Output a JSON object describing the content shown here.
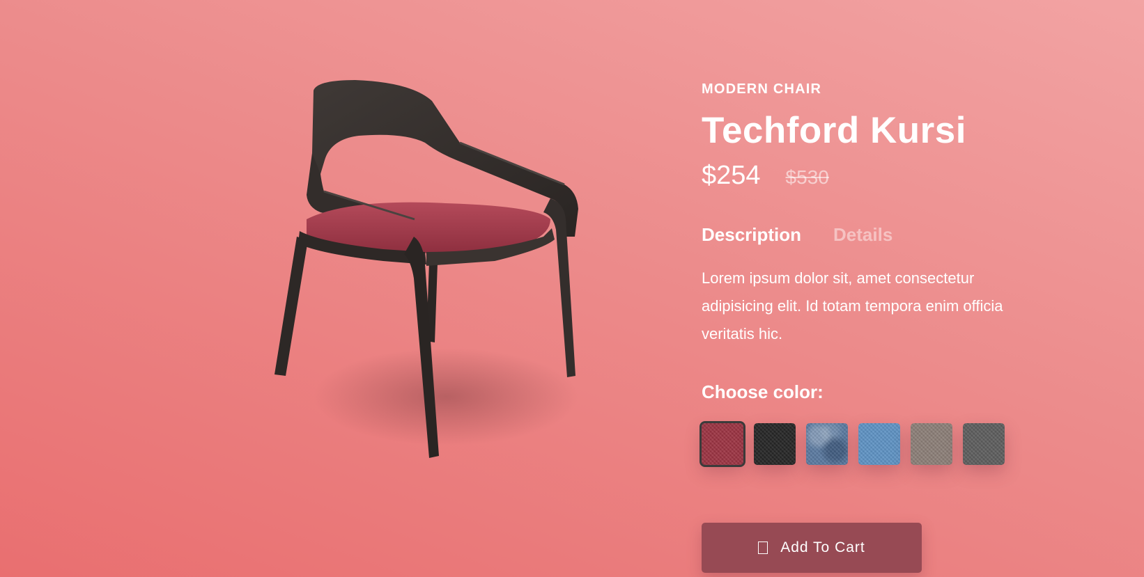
{
  "product": {
    "category": "MODERN CHAIR",
    "name": "Techford Kursi",
    "price": "$254",
    "old_price": "$530",
    "tabs": [
      {
        "label": "Description",
        "active": true
      },
      {
        "label": "Details",
        "active": false
      }
    ],
    "description": "Lorem ipsum dolor sit, amet consectetur adipisicing elit. Id totam tempora enim officia veritatis hic.",
    "choose_color_label": "Choose color:",
    "colors": [
      {
        "name": "red-fabric",
        "hex": "#9c3443",
        "selected": true
      },
      {
        "name": "black-fabric",
        "hex": "#262626",
        "selected": false
      },
      {
        "name": "blue-mottled-fabric",
        "hex": "#5b7aa0",
        "selected": false
      },
      {
        "name": "light-blue-fabric",
        "hex": "#5f93c4",
        "selected": false
      },
      {
        "name": "taupe-fabric",
        "hex": "#8c7f78",
        "selected": false
      },
      {
        "name": "gray-fabric",
        "hex": "#5e5e5e",
        "selected": false
      }
    ],
    "cart_button_label": "Add To Cart",
    "cart_icon": "shopping-bag-icon"
  },
  "theme": {
    "background_top": "#f2a3a3",
    "background_bottom": "#e96f70",
    "button_color": "#974a54"
  }
}
